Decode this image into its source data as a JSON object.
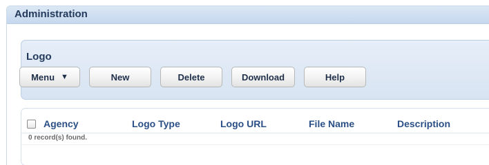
{
  "administration": {
    "title": "Administration"
  },
  "logo_panel": {
    "title": "Logo",
    "buttons": {
      "menu": "Menu",
      "new": "New",
      "delete": "Delete",
      "download": "Download",
      "help": "Help"
    }
  },
  "table": {
    "columns": [
      "Agency",
      "Logo Type",
      "Logo URL",
      "File Name",
      "Description"
    ],
    "select_all_checked": false,
    "status": "0 record(s) found."
  },
  "icons": {
    "menu_dropdown": "menu-dropdown-icon",
    "checkbox": "checkbox-icon"
  },
  "colors": {
    "header_text": "#233a5c",
    "column_text": "#2a4f86",
    "panel_bg": "#d8e4f2"
  }
}
